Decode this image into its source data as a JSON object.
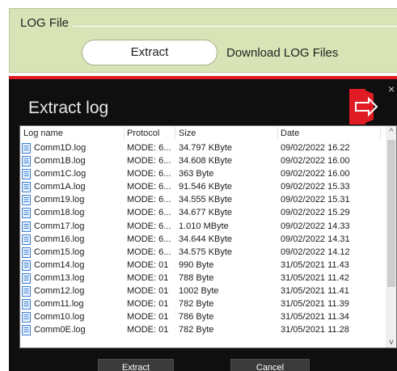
{
  "top_panel": {
    "title": "LOG File",
    "extract_label": "Extract",
    "download_label": "Download LOG Files"
  },
  "dialog": {
    "title": "Extract log",
    "close_glyph": "×",
    "columns": [
      "Log name",
      "Protocol",
      "Size",
      "Date"
    ],
    "rows": [
      {
        "name": "Comm1D.log",
        "protocol": "MODE: 6...",
        "size": "34.797 KByte",
        "date": "09/02/2022 16.22"
      },
      {
        "name": "Comm1B.log",
        "protocol": "MODE: 6...",
        "size": "34.608 KByte",
        "date": "09/02/2022 16.00"
      },
      {
        "name": "Comm1C.log",
        "protocol": "MODE: 6...",
        "size": "363 Byte",
        "date": "09/02/2022 16.00"
      },
      {
        "name": "Comm1A.log",
        "protocol": "MODE: 6...",
        "size": "91.546 KByte",
        "date": "09/02/2022 15.33"
      },
      {
        "name": "Comm19.log",
        "protocol": "MODE: 6...",
        "size": "34.555 KByte",
        "date": "09/02/2022 15.31"
      },
      {
        "name": "Comm18.log",
        "protocol": "MODE: 6...",
        "size": "34.677 KByte",
        "date": "09/02/2022 15.29"
      },
      {
        "name": "Comm17.log",
        "protocol": "MODE: 6...",
        "size": "1.010 MByte",
        "date": "09/02/2022 14.33"
      },
      {
        "name": "Comm16.log",
        "protocol": "MODE: 6...",
        "size": "34.644 KByte",
        "date": "09/02/2022 14.31"
      },
      {
        "name": "Comm15.log",
        "protocol": "MODE: 6...",
        "size": "34.575 KByte",
        "date": "09/02/2022 14.12"
      },
      {
        "name": "Comm14.log",
        "protocol": "MODE: 01",
        "size": "990 Byte",
        "date": "31/05/2021 11.43"
      },
      {
        "name": "Comm13.log",
        "protocol": "MODE: 01",
        "size": "788 Byte",
        "date": "31/05/2021 11.42"
      },
      {
        "name": "Comm12.log",
        "protocol": "MODE: 01",
        "size": "1002 Byte",
        "date": "31/05/2021 11.41"
      },
      {
        "name": "Comm11.log",
        "protocol": "MODE: 01",
        "size": "782 Byte",
        "date": "31/05/2021 11.39"
      },
      {
        "name": "Comm10.log",
        "protocol": "MODE: 01",
        "size": "786 Byte",
        "date": "31/05/2021 11.34"
      },
      {
        "name": "Comm0E.log",
        "protocol": "MODE: 01",
        "size": "782 Byte",
        "date": "31/05/2021 11.28"
      }
    ],
    "extract_label": "Extract",
    "cancel_label": "Cancel",
    "scroll_up_glyph": "^",
    "scroll_down_glyph": "v"
  },
  "colors": {
    "panel_bg": "#d8e4b6",
    "dialog_bg": "#0f0f0f",
    "accent_red": "#e01b24",
    "file_icon_blue": "#3a7fd5"
  },
  "icons": {
    "file": "document-icon",
    "exit": "exit-door-icon"
  }
}
